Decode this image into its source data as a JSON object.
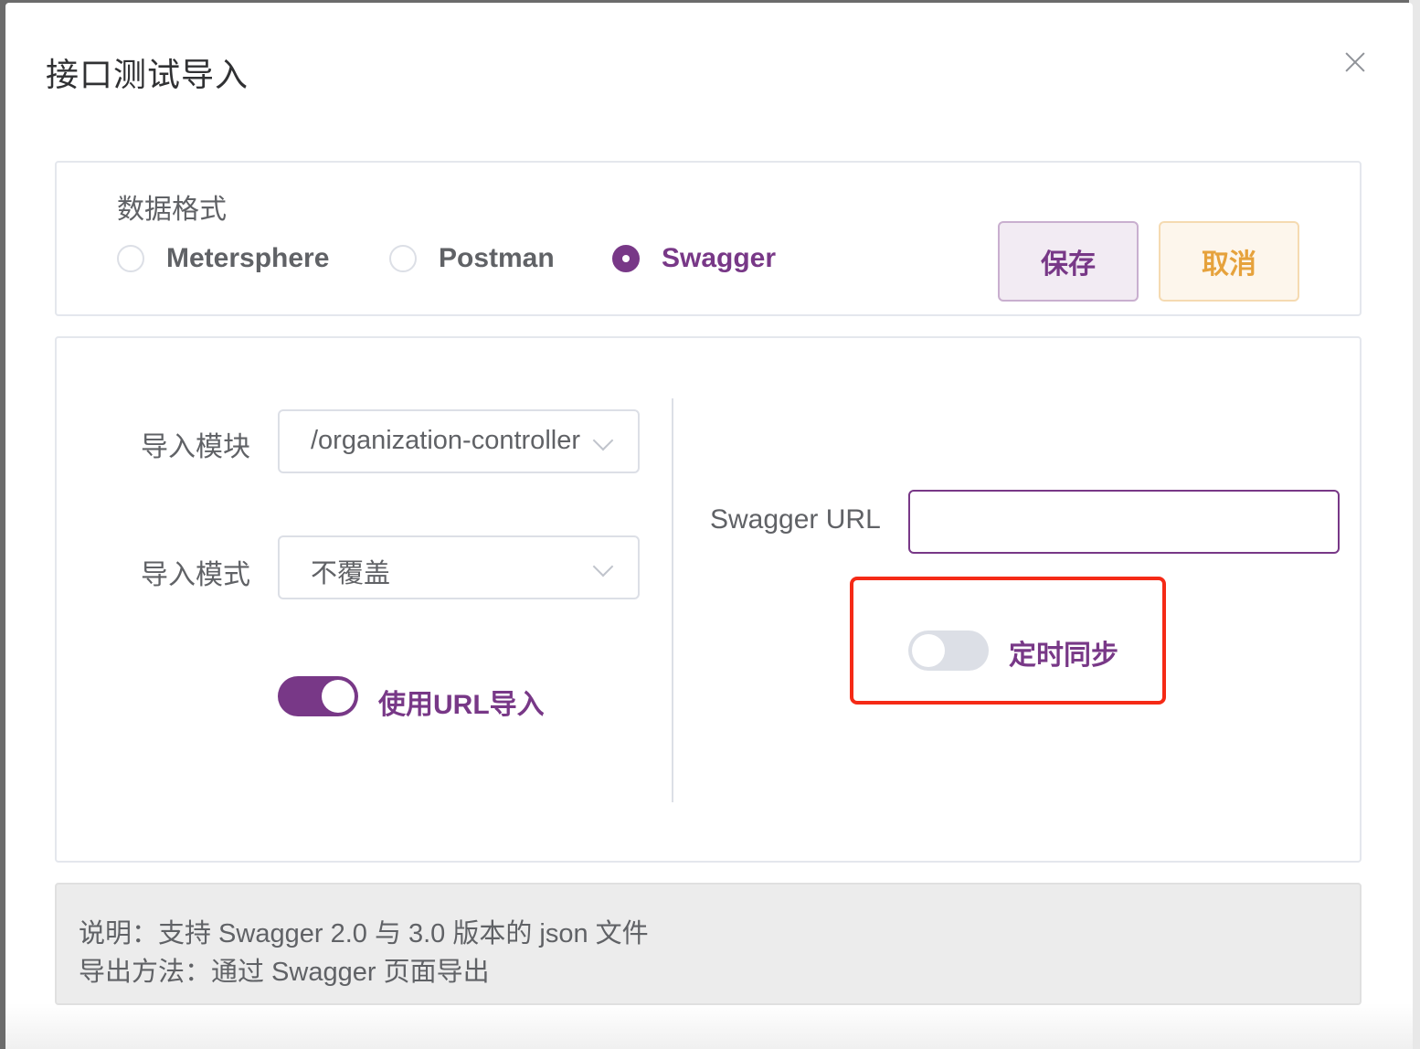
{
  "dialog": {
    "title": "接口测试导入"
  },
  "format": {
    "label": "数据格式",
    "options": [
      {
        "label": "Metersphere",
        "checked": false
      },
      {
        "label": "Postman",
        "checked": false
      },
      {
        "label": "Swagger",
        "checked": true
      }
    ]
  },
  "actions": {
    "save_label": "保存",
    "cancel_label": "取消"
  },
  "form": {
    "module_label": "导入模块",
    "module_value": "/organization-controller",
    "mode_label": "导入模式",
    "mode_value": "不覆盖",
    "use_url_label": "使用URL导入",
    "use_url_enabled": true,
    "swagger_url_label": "Swagger URL",
    "swagger_url_value": "",
    "schedule_sync_label": "定时同步",
    "schedule_sync_enabled": false
  },
  "note": {
    "line1": "说明：支持 Swagger 2.0 与 3.0 版本的 json 文件",
    "line2": "导出方法：通过 Swagger 页面导出"
  },
  "colors": {
    "primary": "#783887",
    "warning": "#e6a23c",
    "highlight": "#f52a16"
  }
}
